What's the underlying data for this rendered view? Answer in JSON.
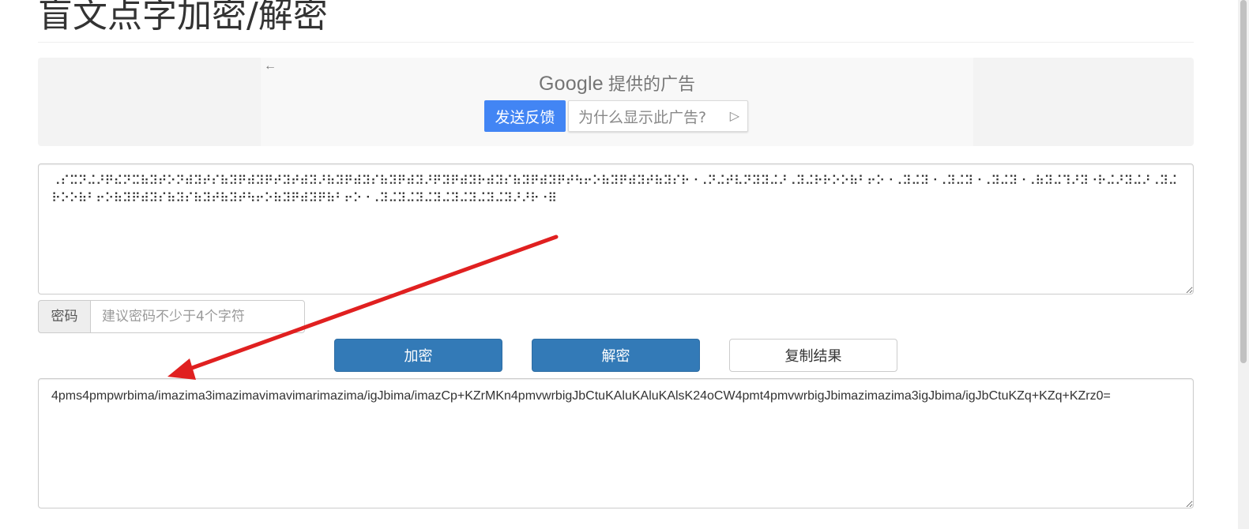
{
  "page": {
    "title": "盲文点字加密/解密"
  },
  "ad": {
    "back_icon": "arrow-left-icon",
    "google_word": "Google",
    "provider_suffix": " 提供的广告",
    "feedback_label": "发送反馈",
    "why_label": "为什么显示此广告?",
    "why_icon": "play-triangle-icon"
  },
  "braille_input": {
    "value": "⠠⠎⠭⠝⠬⠜⠟⠮⠝⠭⠷⠽⠞⠕⠝⠾⠽⠞⠎⠷⠽⠟⠾⠽⠟⠞⠽⠞⠾⠽⠜⠷⠽⠟⠾⠽⠎⠷⠽⠟⠾⠽⠜⠟⠽⠟⠾⠽⠗⠾⠽⠎⠷⠽⠟⠾⠽⠟⠞⠳⠖⠕⠷⠽⠟⠾⠽⠞⠷⠽⠎⠗⠐⠠⠝⠬⠞⠧⠝⠽⠽⠬⠜⠠⠽⠬⠗⠗⠕⠕⠷⠃⠖⠕⠐⠠⠽⠬⠽⠐⠠⠽⠬⠽⠐⠠⠽⠬⠽⠐⠠⠷⠽⠬⠹⠜⠽⠐⠗⠬⠜⠽⠬⠜⠠⠽⠬⠗⠕⠕⠷⠃⠖⠕⠷⠽⠟⠾⠽⠎⠷⠽⠎⠷⠽⠞⠷⠽⠞⠳⠖⠕⠷⠽⠟⠾⠽⠟⠷⠃⠖⠕⠐⠠⠽⠬⠽⠬⠽⠬⠽⠬⠽⠬⠽⠬⠽⠬⠽⠜⠜⠗⠐⠿"
  },
  "password": {
    "label": "密码",
    "placeholder": "建议密码不少于4个字符",
    "value": ""
  },
  "actions": {
    "encrypt_label": "加密",
    "decrypt_label": "解密",
    "copy_label": "复制结果"
  },
  "result_output": {
    "value": "4pms4pmpwrbima/imazima3imazimavimavimarimazima/igJbima/imazCp+KZrMKn4pmvwrbigJbCtuKAluKAluKAlsK24oCW4pmt4pmvwrbigJbimazimazima3igJbima/igJbCtuKZq+KZq+KZrz0="
  },
  "colors": {
    "primary_button": "#337ab7",
    "ad_feedback_button": "#4285f4",
    "annotation_arrow": "#e02020"
  }
}
